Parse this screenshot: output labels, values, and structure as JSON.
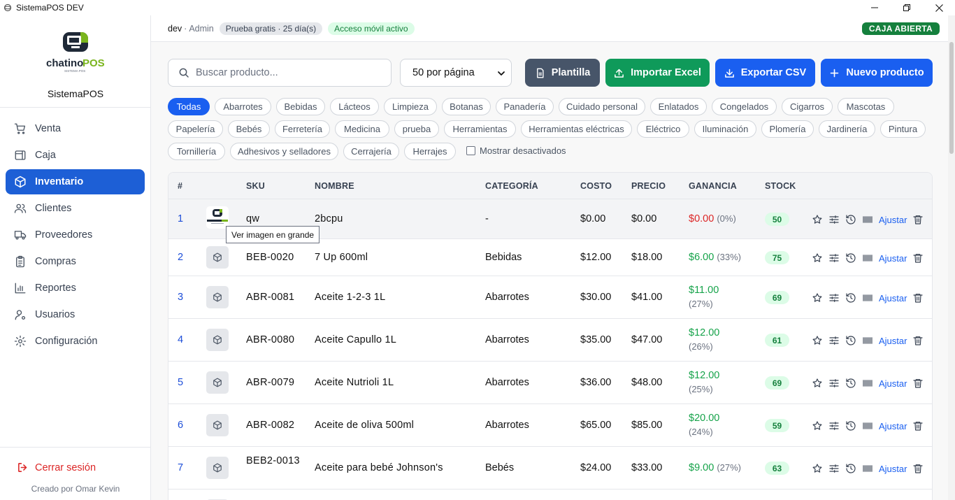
{
  "window": {
    "title": "SistemaPOS DEV",
    "controls": [
      "minimize-icon",
      "restore-icon",
      "close-icon"
    ]
  },
  "sidebar": {
    "logo_text_1": "chatino",
    "logo_text_2": "POS",
    "logo_tagline": "SISTEMA POS",
    "brand": "SistemaPOS",
    "items": [
      {
        "label": "Venta",
        "icon": "cart-icon"
      },
      {
        "label": "Caja",
        "icon": "cash-box-icon"
      },
      {
        "label": "Inventario",
        "icon": "box-icon",
        "active": true
      },
      {
        "label": "Clientes",
        "icon": "users-icon"
      },
      {
        "label": "Proveedores",
        "icon": "truck-icon"
      },
      {
        "label": "Compras",
        "icon": "clipboard-icon"
      },
      {
        "label": "Reportes",
        "icon": "bar-chart-icon"
      },
      {
        "label": "Usuarios",
        "icon": "user-cog-icon"
      },
      {
        "label": "Configuración",
        "icon": "gear-icon"
      }
    ],
    "logout": "Cerrar sesión",
    "credit": "Creado por Omar Kevin"
  },
  "header": {
    "user": "dev",
    "separator": "·",
    "role": "Admin",
    "trial": "Prueba gratis · 25 día(s)",
    "mobile": "Acceso móvil activo",
    "register_status": "CAJA ABIERTA"
  },
  "toolbar": {
    "search_placeholder": "Buscar producto...",
    "per_page": "50 por página",
    "buttons": {
      "template": "Plantilla",
      "import": "Importar Excel",
      "export": "Exportar CSV",
      "new": "Nuevo producto"
    }
  },
  "categories": [
    "Todas",
    "Abarrotes",
    "Bebidas",
    "Lácteos",
    "Limpieza",
    "Botanas",
    "Panadería",
    "Cuidado personal",
    "Enlatados",
    "Congelados",
    "Cigarros",
    "Mascotas",
    "Papelería",
    "Bebés",
    "Ferretería",
    "Medicina",
    "prueba",
    "Herramientas",
    "Herramientas eléctricas",
    "Eléctrico",
    "Iluminación",
    "Plomería",
    "Jardinería",
    "Pintura",
    "Tornillería",
    "Adhesivos y selladores",
    "Cerrajería",
    "Herrajes"
  ],
  "active_category": "Todas",
  "show_inactive": "Mostrar desactivados",
  "table": {
    "columns": {
      "num": "#",
      "sku": "SKU",
      "name": "NOMBRE",
      "category": "CATEGORÍA",
      "cost": "COSTO",
      "price": "PRECIO",
      "gain": "GANANCIA",
      "stock": "STOCK"
    },
    "adjust_label": "Ajustar",
    "rows": [
      {
        "num": "1",
        "sku": "qw",
        "name": "2bcpu",
        "category": "-",
        "cost": "$0.00",
        "price": "$0.00",
        "gain": "$0.00",
        "gain_pct": "(0%)",
        "stock": "50"
      },
      {
        "num": "2",
        "sku": "BEB-0020",
        "name": "7 Up 600ml",
        "category": "Bebidas",
        "cost": "$12.00",
        "price": "$18.00",
        "gain": "$6.00",
        "gain_pct": "(33%)",
        "stock": "75"
      },
      {
        "num": "3",
        "sku": "ABR-0081",
        "name": "Aceite 1-2-3 1L",
        "category": "Abarrotes",
        "cost": "$30.00",
        "price": "$41.00",
        "gain": "$11.00",
        "gain_pct": "(27%)",
        "stock": "69"
      },
      {
        "num": "4",
        "sku": "ABR-0080",
        "name": "Aceite Capullo 1L",
        "category": "Abarrotes",
        "cost": "$35.00",
        "price": "$47.00",
        "gain": "$12.00",
        "gain_pct": "(26%)",
        "stock": "61"
      },
      {
        "num": "5",
        "sku": "ABR-0079",
        "name": "Aceite Nutrioli 1L",
        "category": "Abarrotes",
        "cost": "$36.00",
        "price": "$48.00",
        "gain": "$12.00",
        "gain_pct": "(25%)",
        "stock": "69"
      },
      {
        "num": "6",
        "sku": "ABR-0082",
        "name": "Aceite de oliva 500ml",
        "category": "Abarrotes",
        "cost": "$65.00",
        "price": "$85.00",
        "gain": "$20.00",
        "gain_pct": "(24%)",
        "stock": "59"
      },
      {
        "num": "7",
        "sku": "BEB2-0013",
        "name": "Aceite para bebé Johnson's",
        "category": "Bebés",
        "cost": "$24.00",
        "price": "$33.00",
        "gain": "$9.00",
        "gain_pct": "(27%)",
        "stock": "63"
      }
    ]
  },
  "tooltip": "Ver imagen en grande",
  "colors": {
    "accent": "#1a5ff0",
    "success": "#15803d",
    "danger": "#dc2626"
  }
}
